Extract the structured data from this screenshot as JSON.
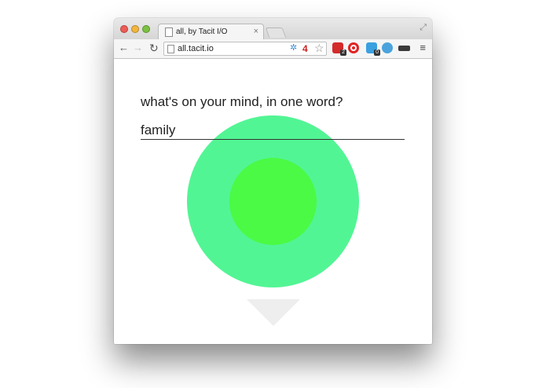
{
  "browser": {
    "tab": {
      "title": "all, by Tacit I/O",
      "close_glyph": "×"
    },
    "toolbar": {
      "back_glyph": "←",
      "forward_glyph": "→",
      "reload_glyph": "↻",
      "url": "all.tacit.io",
      "extension_count": "4",
      "star_glyph": "☆",
      "menu_glyph": "≡",
      "extensions": [
        {
          "icon": "lastpass-icon",
          "badge": "2"
        },
        {
          "icon": "opera-icon"
        },
        {
          "icon": "ghostery-icon",
          "badge": "0"
        },
        {
          "icon": "vimium-icon"
        },
        {
          "icon": "mask-icon"
        }
      ]
    },
    "fullscreen_glyph": "⤢"
  },
  "page": {
    "prompt": "what's on your mind, in one word?",
    "answer_value": "family",
    "colors": {
      "outer_circle": "#52f594",
      "inner_circle": "#4afa45",
      "arrow": "#eeeeee"
    }
  }
}
